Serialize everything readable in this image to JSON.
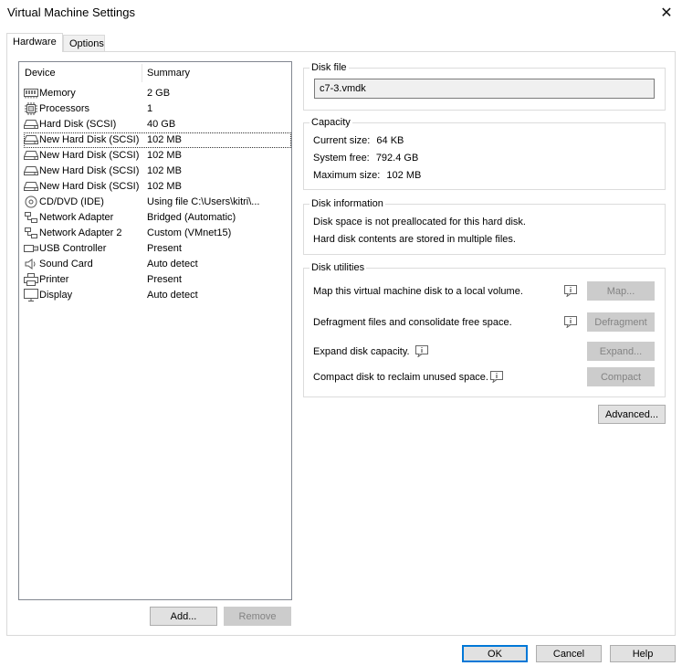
{
  "window": {
    "title": "Virtual Machine Settings",
    "close_glyph": "✕"
  },
  "tabs": [
    {
      "label": "Hardware",
      "active": true
    },
    {
      "label": "Options",
      "active": false
    }
  ],
  "device_list": {
    "headers": {
      "device": "Device",
      "summary": "Summary"
    },
    "rows": [
      {
        "icon": "memory-icon",
        "device": "Memory",
        "summary": "2 GB"
      },
      {
        "icon": "processor-icon",
        "device": "Processors",
        "summary": "1"
      },
      {
        "icon": "hard-disk-icon",
        "device": "Hard Disk (SCSI)",
        "summary": "40 GB"
      },
      {
        "icon": "hard-disk-icon",
        "device": "New Hard Disk (SCSI)",
        "summary": "102 MB",
        "selected": true
      },
      {
        "icon": "hard-disk-icon",
        "device": "New Hard Disk (SCSI)",
        "summary": "102 MB"
      },
      {
        "icon": "hard-disk-icon",
        "device": "New Hard Disk (SCSI)",
        "summary": "102 MB"
      },
      {
        "icon": "hard-disk-icon",
        "device": "New Hard Disk (SCSI)",
        "summary": "102 MB"
      },
      {
        "icon": "cd-dvd-icon",
        "device": "CD/DVD (IDE)",
        "summary": "Using file C:\\Users\\kitri\\..."
      },
      {
        "icon": "network-adapter-icon",
        "device": "Network Adapter",
        "summary": "Bridged (Automatic)"
      },
      {
        "icon": "network-adapter-icon",
        "device": "Network Adapter 2",
        "summary": "Custom (VMnet15)"
      },
      {
        "icon": "usb-icon",
        "device": "USB Controller",
        "summary": "Present"
      },
      {
        "icon": "sound-icon",
        "device": "Sound Card",
        "summary": "Auto detect"
      },
      {
        "icon": "printer-icon",
        "device": "Printer",
        "summary": "Present"
      },
      {
        "icon": "display-icon",
        "device": "Display",
        "summary": "Auto detect"
      }
    ]
  },
  "list_buttons": {
    "add": "Add...",
    "remove": "Remove"
  },
  "disk_file": {
    "title": "Disk file",
    "value": "c7-3.vmdk"
  },
  "capacity": {
    "title": "Capacity",
    "current_size_label": "Current size:",
    "current_size": "64 KB",
    "system_free_label": "System free:",
    "system_free": "792.4 GB",
    "max_size_label": "Maximum size:",
    "max_size": "102 MB"
  },
  "disk_info": {
    "title": "Disk information",
    "line1": "Disk space is not preallocated for this hard disk.",
    "line2": "Hard disk contents are stored in multiple files."
  },
  "disk_utilities": {
    "title": "Disk utilities",
    "map_text": "Map this virtual machine disk to a local volume.",
    "map_button": "Map...",
    "defrag_text": "Defragment files and consolidate free space.",
    "defrag_button": "Defragment",
    "expand_text": "Expand disk capacity.",
    "expand_button": "Expand...",
    "compact_text": "Compact disk to reclaim unused space.",
    "compact_button": "Compact"
  },
  "advanced_button": "Advanced...",
  "footer": {
    "ok": "OK",
    "cancel": "Cancel",
    "help": "Help"
  },
  "colors": {
    "focus_border": "#0078d7",
    "disabled_text": "#838383",
    "button_face": "#e1e1e1"
  }
}
